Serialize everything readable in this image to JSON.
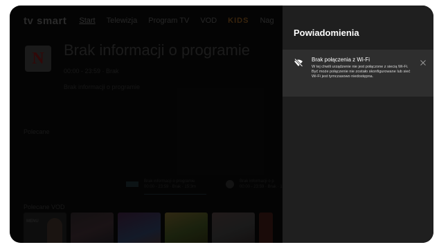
{
  "nav": {
    "logo_text": "tv smart",
    "items": [
      {
        "label": "Start",
        "active": true
      },
      {
        "label": "Telewizja"
      },
      {
        "label": "Program TV"
      },
      {
        "label": "VOD"
      },
      {
        "label": "KIDS"
      },
      {
        "label": "Nag"
      }
    ]
  },
  "program": {
    "channel_logo": "N",
    "title": "Brak informacji o programie",
    "time": "00:00 - 23:59 · Brak",
    "description": "Brak informacji o programie"
  },
  "recommended": {
    "label": "Polecane",
    "cards": [
      {
        "title": "Brak informacji o programie",
        "meta": "00:00 - 23:59 · Brak · 15:3m"
      },
      {
        "title": "Brak informacji o p",
        "meta": "00:00 - 23:59 · Brak · 15:"
      }
    ]
  },
  "vod": {
    "label": "Polecane VOD",
    "first_tile_label": "MENU"
  },
  "notifications": {
    "title": "Powiadomienia",
    "item": {
      "title": "Brak połączenia z Wi-Fi",
      "body": "W tej chwili urządzenie nie jest połączone z siecią Wi-Fi. Być może połączenie nie zostało skonfigurowane lub sieć Wi-Fi jest tymczasowo niedostępna.",
      "icon": "wifi-off-icon"
    },
    "close_icon": "close-icon"
  },
  "colors": {
    "panel_bg": "#1f1f1f",
    "notification_bg": "#2e2e2e",
    "accent_kids": "#e08a1e",
    "brand_red": "#e50914"
  }
}
